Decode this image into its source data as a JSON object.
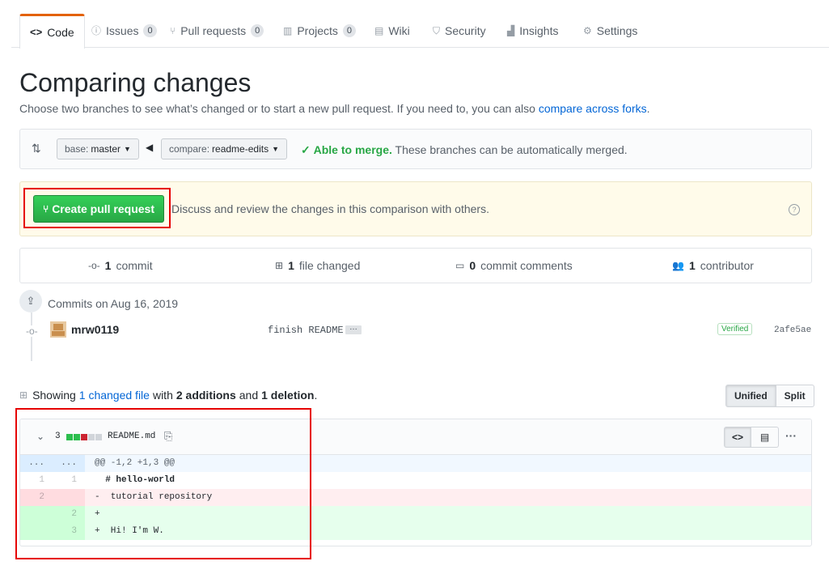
{
  "nav": {
    "tabs": [
      {
        "label": "Code",
        "icon": "code-icon"
      },
      {
        "label": "Issues",
        "count": "0",
        "icon": "issue-icon"
      },
      {
        "label": "Pull requests",
        "count": "0",
        "icon": "pull-request-icon"
      },
      {
        "label": "Projects",
        "count": "0",
        "icon": "project-icon"
      },
      {
        "label": "Wiki",
        "icon": "book-icon"
      },
      {
        "label": "Security",
        "icon": "shield-icon"
      },
      {
        "label": "Insights",
        "icon": "graph-icon"
      },
      {
        "label": "Settings",
        "icon": "gear-icon"
      }
    ]
  },
  "page": {
    "title": "Comparing changes",
    "subtitle": "Choose two branches to see what’s changed or to start a new pull request. If you need to, you can also",
    "subtitle_link": "compare across forks",
    "subtitle_end": "."
  },
  "range": {
    "base_prefix": "base:",
    "base_value": "master",
    "compare_prefix": "compare:",
    "compare_value": "readme-edits",
    "merge_status": "Able to merge.",
    "merge_detail": "These branches can be automatically merged."
  },
  "flash": {
    "create_button": "Create pull request",
    "text": "Discuss and review the changes in this comparison with others."
  },
  "stats": {
    "commits_num": "1",
    "commits_label": "commit",
    "files_num": "1",
    "files_label": "file changed",
    "comments_num": "0",
    "comments_label": "commit comments",
    "contributors_num": "1",
    "contributors_label": "contributor"
  },
  "commits": {
    "date_label": "Commits on Aug 16, 2019",
    "items": [
      {
        "author": "mrw0119",
        "message": "finish README",
        "ellipsis": "…",
        "badge": "Verified",
        "sha": "2afe5ae"
      }
    ]
  },
  "diff_summary": {
    "prefix": "Showing",
    "link": "1 changed file",
    "with": "with",
    "additions": "2 additions",
    "and": "and",
    "deletions": "1 deletion",
    "end": ".",
    "unified_label": "Unified",
    "split_label": "Split"
  },
  "file": {
    "change_count": "3",
    "name": "README.md",
    "diffstat_colors": [
      "#2cbe4e",
      "#2cbe4e",
      "#cb2431",
      "#d1d5da",
      "#d1d5da"
    ],
    "lines": [
      {
        "type": "hunk",
        "left": "...",
        "right": "...",
        "code": "@@ -1,2 +1,3 @@"
      },
      {
        "type": "ctx",
        "left": "1",
        "right": "1",
        "code": "  # hello-world"
      },
      {
        "type": "del",
        "left": "2",
        "right": "",
        "code": "-  tutorial repository"
      },
      {
        "type": "add",
        "left": "",
        "right": "2",
        "code": "+"
      },
      {
        "type": "add",
        "left": "",
        "right": "3",
        "code": "+  Hi! I'm W."
      }
    ]
  },
  "colors": {
    "accent_green": "#28a745",
    "link_blue": "#0366d6",
    "highlight_red": "#e60000",
    "tab_active_orange": "#e36209"
  }
}
